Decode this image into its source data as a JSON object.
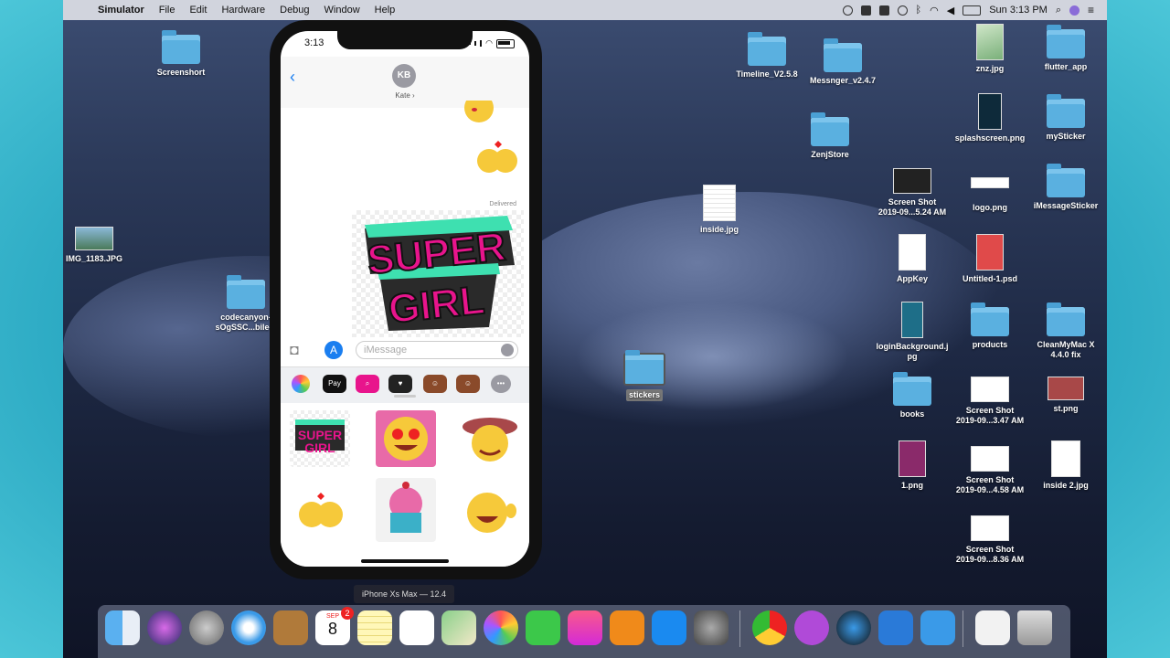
{
  "menubar": {
    "app": "Simulator",
    "items": [
      "File",
      "Edit",
      "Hardware",
      "Debug",
      "Window",
      "Help"
    ],
    "clock": "Sun 3:13 PM"
  },
  "desktop_icons": [
    {
      "label": "Screenshort"
    },
    {
      "label": "IMG_1183.JPG"
    },
    {
      "label": "codecanyon-",
      "label2": "sOgSSC...bile-a"
    },
    {
      "label": "Timeline_V2.5.8"
    },
    {
      "label": "Messnger_v2.4.7"
    },
    {
      "label": "ZenjStore"
    },
    {
      "label": "inside.jpg"
    },
    {
      "label": "stickers"
    },
    {
      "label": "znz.jpg"
    },
    {
      "label": "flutter_app"
    },
    {
      "label": "splashscreen.png"
    },
    {
      "label": "mySticker"
    },
    {
      "label": "Screen Shot",
      "label2": "2019-09...5.24 AM"
    },
    {
      "label": "logo.png"
    },
    {
      "label": "iMessageSticker"
    },
    {
      "label": "AppKey"
    },
    {
      "label": "Untitled-1.psd"
    },
    {
      "label": "loginBackground.j",
      "label2": "pg"
    },
    {
      "label": "products"
    },
    {
      "label": "CleanMyMac X",
      "label2": "4.4.0 fix"
    },
    {
      "label": "books"
    },
    {
      "label": "Screen Shot",
      "label2": "2019-09...3.47 AM"
    },
    {
      "label": "st.png"
    },
    {
      "label": "1.png"
    },
    {
      "label": "Screen Shot",
      "label2": "2019-09...4.58 AM"
    },
    {
      "label": "inside 2.jpg"
    },
    {
      "label": "Screen Shot",
      "label2": "2019-09...8.36 AM"
    }
  ],
  "phone": {
    "time": "3:13",
    "avatar": "KB",
    "contact": "Kate ›",
    "delivered": "Delivered",
    "placeholder": "iMessage",
    "sticker_text_line1": "SUPER",
    "sticker_text_line2": "GIRL",
    "app_pay": "Pay",
    "device_label": "iPhone Xs Max — 12.4"
  },
  "dock": {
    "calendar_month": "SEP",
    "calendar_day": "8",
    "badge": "2"
  },
  "colors": {
    "imessage_blue": "#1a7ef0",
    "sticker_pink": "#e8148c",
    "sticker_teal": "#3ee0b0",
    "folder_blue": "#5ab0e0"
  }
}
